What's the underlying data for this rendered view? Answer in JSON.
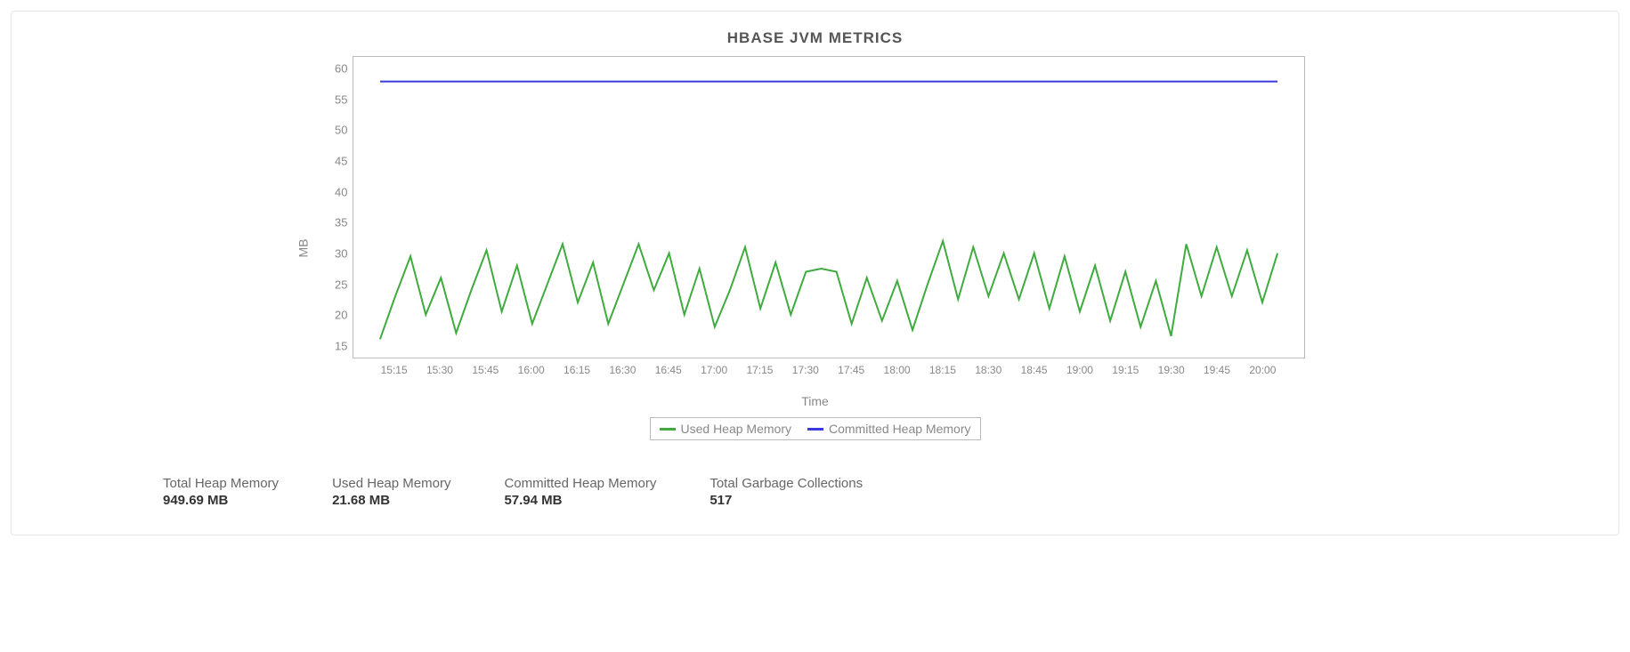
{
  "chart_data": {
    "type": "line",
    "title": "HBASE JVM METRICS",
    "xlabel": "Time",
    "ylabel": "MB",
    "ylim": [
      13,
      62
    ],
    "x": [
      "15:10",
      "15:15",
      "15:20",
      "15:25",
      "15:30",
      "15:35",
      "15:40",
      "15:45",
      "15:50",
      "15:55",
      "16:00",
      "16:05",
      "16:10",
      "16:15",
      "16:20",
      "16:25",
      "16:30",
      "16:35",
      "16:40",
      "16:45",
      "16:50",
      "16:55",
      "17:00",
      "17:05",
      "17:10",
      "17:15",
      "17:20",
      "17:25",
      "17:30",
      "17:35",
      "17:40",
      "17:45",
      "17:50",
      "17:55",
      "18:00",
      "18:05",
      "18:10",
      "18:15",
      "18:20",
      "18:25",
      "18:30",
      "18:35",
      "18:40",
      "18:45",
      "18:50",
      "18:55",
      "19:00",
      "19:05",
      "19:10",
      "19:15",
      "19:20",
      "19:25",
      "19:30",
      "19:35",
      "19:40",
      "19:45",
      "19:50",
      "19:55",
      "20:00",
      "20:05"
    ],
    "x_ticks": [
      "15:15",
      "15:30",
      "15:45",
      "16:00",
      "16:15",
      "16:30",
      "16:45",
      "17:00",
      "17:15",
      "17:30",
      "17:45",
      "18:00",
      "18:15",
      "18:30",
      "18:45",
      "19:00",
      "19:15",
      "19:30",
      "19:45",
      "20:00"
    ],
    "y_ticks": [
      15,
      20,
      25,
      30,
      35,
      40,
      45,
      50,
      55,
      60
    ],
    "series": [
      {
        "name": "Used Heap Memory",
        "color": "#3fab3f",
        "values": [
          16,
          23,
          29.5,
          20,
          26,
          17,
          24,
          30.5,
          20.5,
          28,
          18.5,
          25,
          31.5,
          22,
          28.5,
          18.5,
          25,
          31.5,
          24,
          30,
          20,
          27.5,
          18,
          24,
          31,
          21,
          28.5,
          20,
          27,
          27.5,
          27,
          18.5,
          26,
          19,
          25.5,
          17.5,
          25,
          32,
          22.5,
          31,
          23,
          30,
          22.5,
          30,
          21,
          29.5,
          20.5,
          28,
          19,
          27,
          18,
          25.5,
          16.5,
          31.5,
          23,
          31,
          23,
          30.5,
          22,
          30
        ]
      },
      {
        "name": "Committed Heap Memory",
        "color": "#3a3adf",
        "values": [
          58,
          58,
          58,
          58,
          58,
          58,
          58,
          58,
          58,
          58,
          58,
          58,
          58,
          58,
          58,
          58,
          58,
          58,
          58,
          58,
          58,
          58,
          58,
          58,
          58,
          58,
          58,
          58,
          58,
          58,
          58,
          58,
          58,
          58,
          58,
          58,
          58,
          58,
          58,
          58,
          58,
          58,
          58,
          58,
          58,
          58,
          58,
          58,
          58,
          58,
          58,
          58,
          58,
          58,
          58,
          58,
          58,
          58,
          58,
          58
        ]
      }
    ],
    "legend_position": "bottom"
  },
  "stats": [
    {
      "label": "Total Heap Memory",
      "value": "949.69 MB"
    },
    {
      "label": "Used Heap Memory",
      "value": "21.68 MB"
    },
    {
      "label": "Committed Heap Memory",
      "value": "57.94 MB"
    },
    {
      "label": "Total Garbage Collections",
      "value": "517"
    }
  ]
}
